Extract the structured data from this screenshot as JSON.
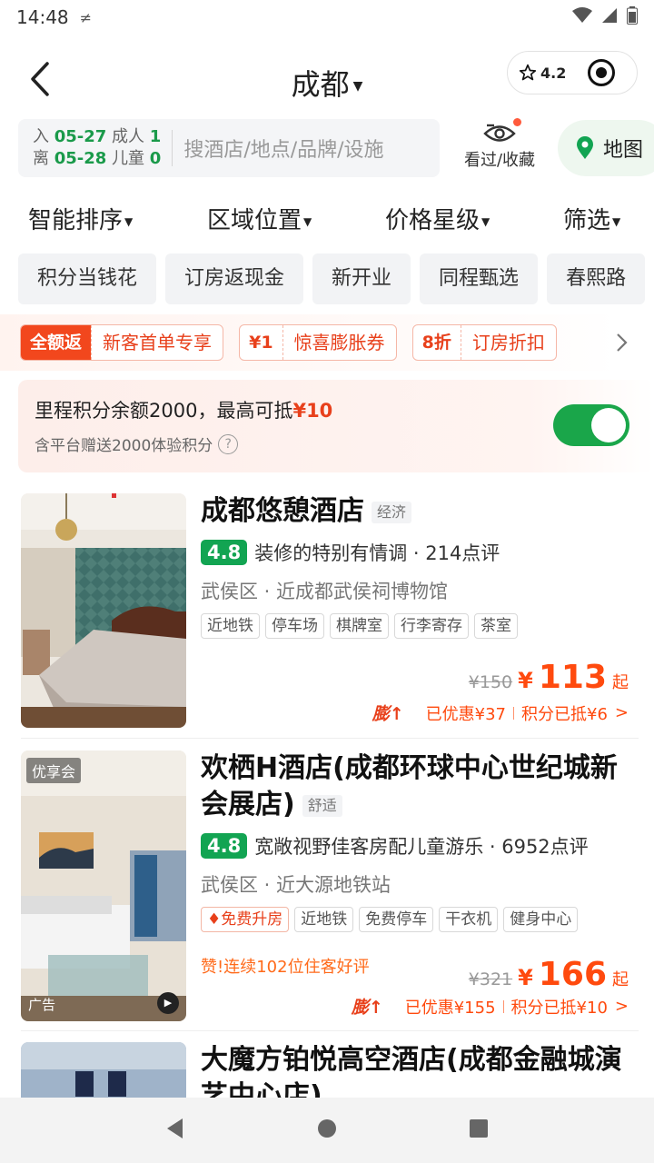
{
  "status_bar": {
    "time": "14:48"
  },
  "header": {
    "city": "成都",
    "capsule_rating": "4.2"
  },
  "search": {
    "checkin_label": "入",
    "checkin_date": "05-27",
    "checkout_label": "离",
    "checkout_date": "05-28",
    "adult_label": "成人",
    "adult_count": "1",
    "child_label": "儿童",
    "child_count": "0",
    "placeholder": "搜酒店/地点/品牌/设施",
    "history_label": "看过/收藏",
    "map_label": "地图"
  },
  "sort_bar": {
    "items": [
      "智能排序",
      "区域位置",
      "价格星级",
      "筛选"
    ]
  },
  "chips": [
    "积分当钱花",
    "订房返现金",
    "新开业",
    "同程甄选",
    "春熙路"
  ],
  "promos": [
    {
      "left": "全额返",
      "right": "新客首单专享"
    },
    {
      "left": "¥1",
      "right": "惊喜膨胀券"
    },
    {
      "left": "8折",
      "right": "订房折扣"
    }
  ],
  "points": {
    "text": "里程积分余额2000，最高可抵",
    "amount": "¥10",
    "sub": "含平台赠送2000体验积分",
    "toggle_on": true
  },
  "hotels": [
    {
      "name": "成都悠憩酒店",
      "grade": "经济",
      "score": "4.8",
      "review_text": "装修的特别有情调 · 214点评",
      "location": "武侯区 · 近成都武侯祠博物馆",
      "tags": [
        "近地铁",
        "停车场",
        "棋牌室",
        "行李寄存",
        "茶室"
      ],
      "old_price": "¥150",
      "price": "113",
      "price_suffix": "起",
      "inflate": "膨↑",
      "discount": "已优惠¥37",
      "points_deduct": "积分已抵¥6",
      "chevron": ">"
    },
    {
      "name": "欢栖H酒店(成都环球中心世纪城新会展店)",
      "grade": "舒适",
      "score": "4.8",
      "review_text": "宽敞视野佳客房配儿童游乐 · 6952点评",
      "location": "武侯区 · 近大源地铁站",
      "upgrade_tag": "免费升房",
      "tags": [
        "近地铁",
        "免费停车",
        "干衣机",
        "健身中心"
      ],
      "praise": "赞!连续102位住客好评",
      "badge": "优享会",
      "ad": "广告",
      "old_price": "¥321",
      "price": "166",
      "price_suffix": "起",
      "inflate": "膨↑",
      "discount": "已优惠¥155",
      "points_deduct": "积分已抵¥10",
      "chevron": ">"
    },
    {
      "name": "大魔方铂悦高空酒店(成都金融城演艺中心店)"
    }
  ],
  "currency": "¥",
  "colors": {
    "accent_green": "#12a452",
    "price_orange": "#ff4a0e",
    "promo_red": "#f2471d"
  }
}
